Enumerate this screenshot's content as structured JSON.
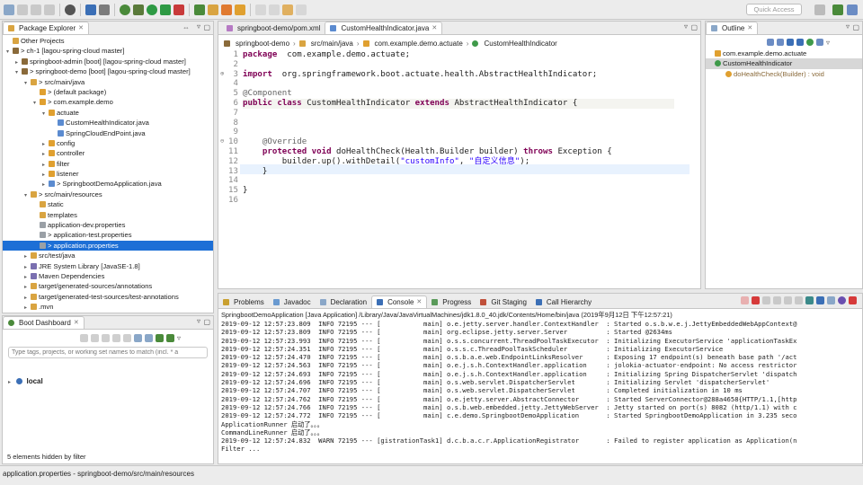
{
  "toolbar": {
    "quick_access_placeholder": "Quick Access"
  },
  "package_explorer": {
    "tab_label": "Package Explorer",
    "items": [
      {
        "label": "Other Projects",
        "indent": 0,
        "arrow": "",
        "icon": "folder-icon",
        "color": "#d9a441"
      },
      {
        "label": "> ch-1 [lagou-spring-cloud master]",
        "indent": 0,
        "arrow": "▾",
        "icon": "project-icon",
        "color": "#8a6a3a"
      },
      {
        "label": "springboot-admin [boot] [lagou-spring-cloud master]",
        "indent": 1,
        "arrow": "▸",
        "icon": "project-icon",
        "color": "#8a6a3a"
      },
      {
        "label": "> springboot-demo [boot] [lagou-spring-cloud master]",
        "indent": 1,
        "arrow": "▾",
        "icon": "project-icon",
        "color": "#8a6a3a"
      },
      {
        "label": "> src/main/java",
        "indent": 2,
        "arrow": "▾",
        "icon": "source-folder-icon",
        "color": "#d9a441"
      },
      {
        "label": "> (default package)",
        "indent": 3,
        "arrow": "",
        "icon": "package-icon",
        "color": "#e0a030"
      },
      {
        "label": "> com.example.demo",
        "indent": 3,
        "arrow": "▾",
        "icon": "package-icon",
        "color": "#e0a030"
      },
      {
        "label": "actuate",
        "indent": 4,
        "arrow": "▾",
        "icon": "package-icon",
        "color": "#e0a030"
      },
      {
        "label": "CustomHealthIndicator.java",
        "indent": 5,
        "arrow": "",
        "icon": "java-file-icon",
        "color": "#5b8bd0"
      },
      {
        "label": "SpringCloudEndPoint.java",
        "indent": 5,
        "arrow": "",
        "icon": "java-file-icon",
        "color": "#5b8bd0"
      },
      {
        "label": "config",
        "indent": 4,
        "arrow": "▸",
        "icon": "package-icon",
        "color": "#e0a030"
      },
      {
        "label": "controller",
        "indent": 4,
        "arrow": "▸",
        "icon": "package-icon",
        "color": "#e0a030"
      },
      {
        "label": "filter",
        "indent": 4,
        "arrow": "▸",
        "icon": "package-icon",
        "color": "#e0a030"
      },
      {
        "label": "listener",
        "indent": 4,
        "arrow": "▸",
        "icon": "package-icon",
        "color": "#e0a030"
      },
      {
        "label": "> SpringbootDemoApplication.java",
        "indent": 4,
        "arrow": "▸",
        "icon": "java-file-icon",
        "color": "#5b8bd0"
      },
      {
        "label": "> src/main/resources",
        "indent": 2,
        "arrow": "▾",
        "icon": "source-folder-icon",
        "color": "#d9a441"
      },
      {
        "label": "static",
        "indent": 3,
        "arrow": "",
        "icon": "folder-icon",
        "color": "#d9a441"
      },
      {
        "label": "templates",
        "indent": 3,
        "arrow": "",
        "icon": "folder-icon",
        "color": "#d9a441"
      },
      {
        "label": "application-dev.properties",
        "indent": 3,
        "arrow": "",
        "icon": "properties-file-icon",
        "color": "#9aa0a6"
      },
      {
        "label": "> application-test.properties",
        "indent": 3,
        "arrow": "",
        "icon": "properties-file-icon",
        "color": "#9aa0a6"
      },
      {
        "label": "> application.properties",
        "indent": 3,
        "arrow": "",
        "icon": "properties-file-icon",
        "color": "#9aa0a6",
        "selected": true
      },
      {
        "label": "src/test/java",
        "indent": 2,
        "arrow": "▸",
        "icon": "source-folder-icon",
        "color": "#d9a441"
      },
      {
        "label": "JRE System Library [JavaSE-1.8]",
        "indent": 2,
        "arrow": "▸",
        "icon": "library-icon",
        "color": "#7a6fb0"
      },
      {
        "label": "Maven Dependencies",
        "indent": 2,
        "arrow": "▸",
        "icon": "library-icon",
        "color": "#7a6fb0"
      },
      {
        "label": "target/generated-sources/annotations",
        "indent": 2,
        "arrow": "▸",
        "icon": "source-folder-icon",
        "color": "#d9a441"
      },
      {
        "label": "target/generated-test-sources/test-annotations",
        "indent": 2,
        "arrow": "▸",
        "icon": "source-folder-icon",
        "color": "#d9a441"
      },
      {
        "label": ".mvn",
        "indent": 2,
        "arrow": "▸",
        "icon": "folder-icon",
        "color": "#d9a441"
      }
    ]
  },
  "boot_dashboard": {
    "tab_label": "Boot Dashboard",
    "search_placeholder": "Type tags, projects, or working set names to match (incl. * a",
    "local_label": "local",
    "hidden_note": "5 elements hidden by filter"
  },
  "editor": {
    "tabs": [
      {
        "label": "springboot-demo/pom.xml",
        "active": false
      },
      {
        "label": "CustomHealthIndicator.java",
        "active": true
      }
    ],
    "breadcrumb": [
      "springboot-demo",
      "src/main/java",
      "com.example.demo.actuate",
      "CustomHealthIndicator"
    ],
    "lines": [
      {
        "n": "1",
        "marker": "",
        "parts": [
          [
            "kw",
            "package"
          ],
          [
            "",
            "  com.example.demo.actuate;"
          ]
        ]
      },
      {
        "n": "2",
        "marker": "",
        "parts": []
      },
      {
        "n": "3",
        "marker": "⊕",
        "parts": [
          [
            "kw",
            "import"
          ],
          [
            "",
            "  org.springframework.boot.actuate.health.AbstractHealthIndicator;"
          ]
        ]
      },
      {
        "n": "4",
        "marker": "",
        "parts": []
      },
      {
        "n": "5",
        "marker": "",
        "parts": [
          [
            "an",
            "@Component"
          ]
        ]
      },
      {
        "n": "6",
        "marker": "",
        "parts": [
          [
            "kw",
            "public"
          ],
          [
            "",
            " "
          ],
          [
            "kw",
            "class"
          ],
          [
            "",
            " CustomHealthIndicator "
          ],
          [
            "kw",
            "extends"
          ],
          [
            "",
            " AbstractHealthIndicator {"
          ]
        ]
      },
      {
        "n": "7",
        "marker": "",
        "parts": []
      },
      {
        "n": "8",
        "marker": "",
        "parts": []
      },
      {
        "n": "9",
        "marker": "",
        "parts": []
      },
      {
        "n": "10",
        "marker": "⊖",
        "parts": [
          [
            "",
            "    "
          ],
          [
            "an",
            "@Override"
          ]
        ]
      },
      {
        "n": "11",
        "marker": "",
        "parts": [
          [
            "",
            "    "
          ],
          [
            "kw",
            "protected"
          ],
          [
            "",
            " "
          ],
          [
            "kw",
            "void"
          ],
          [
            "",
            " doHealthCheck(Health.Builder builder) "
          ],
          [
            "kw",
            "throws"
          ],
          [
            "",
            " Exception {"
          ]
        ]
      },
      {
        "n": "12",
        "marker": "",
        "parts": [
          [
            "",
            "        builder.up().withDetail("
          ],
          [
            "str",
            "\"customInfo\""
          ],
          [
            "",
            ", "
          ],
          [
            "str",
            "\"自定义信息\""
          ],
          [
            "",
            ");"
          ]
        ]
      },
      {
        "n": "13",
        "marker": "",
        "parts": [
          [
            "",
            "    }"
          ]
        ]
      },
      {
        "n": "14",
        "marker": "",
        "parts": []
      },
      {
        "n": "15",
        "marker": "",
        "parts": [
          [
            "",
            "}"
          ]
        ]
      },
      {
        "n": "16",
        "marker": "",
        "parts": []
      }
    ]
  },
  "outline": {
    "tab_label": "Outline",
    "items": [
      {
        "label": "com.example.demo.actuate",
        "indent": 0
      },
      {
        "label": "CustomHealthIndicator",
        "indent": 0,
        "selected": true
      },
      {
        "label": "doHealthCheck(Builder) : void",
        "indent": 1
      }
    ]
  },
  "bottom_tabs": [
    {
      "label": "Problems",
      "active": false
    },
    {
      "label": "Javadoc",
      "active": false
    },
    {
      "label": "Declaration",
      "active": false
    },
    {
      "label": "Console",
      "active": true
    },
    {
      "label": "Progress",
      "active": false
    },
    {
      "label": "Git Staging",
      "active": false
    },
    {
      "label": "Call Hierarchy",
      "active": false
    }
  ],
  "console": {
    "header": "SpringbootDemoApplication [Java Application] /Library/Java/JavaVirtualMachines/jdk1.8.0_40.jdk/Contents/Home/bin/java (2019年9月12日 下午12:57:21)",
    "lines": [
      "2019-09-12 12:57:23.809  INFO 72195 --- [           main] o.e.jetty.server.handler.ContextHandler  : Started o.s.b.w.e.j.JettyEmbeddedWebAppContext@",
      "2019-09-12 12:57:23.809  INFO 72195 --- [           main] org.eclipse.jetty.server.Server          : Started @2634ms",
      "2019-09-12 12:57:23.993  INFO 72195 --- [           main] o.s.s.concurrent.ThreadPoolTaskExecutor  : Initializing ExecutorService 'applicationTaskEx",
      "2019-09-12 12:57:24.351  INFO 72195 --- [           main] o.s.s.c.ThreadPoolTaskScheduler          : Initializing ExecutorService",
      "2019-09-12 12:57:24.470  INFO 72195 --- [           main] o.s.b.a.e.web.EndpointLinksResolver      : Exposing 17 endpoint(s) beneath base path '/act",
      "2019-09-12 12:57:24.563  INFO 72195 --- [           main] o.e.j.s.h.ContextHandler.application     : jolokia-actuator-endpoint: No access restrictor",
      "2019-09-12 12:57:24.693  INFO 72195 --- [           main] o.e.j.s.h.ContextHandler.application     : Initializing Spring DispatcherServlet 'dispatch",
      "2019-09-12 12:57:24.696  INFO 72195 --- [           main] o.s.web.servlet.DispatcherServlet        : Initializing Servlet 'dispatcherServlet'",
      "2019-09-12 12:57:24.707  INFO 72195 --- [           main] o.s.web.servlet.DispatcherServlet        : Completed initialization in 10 ms",
      "2019-09-12 12:57:24.762  INFO 72195 --- [           main] o.e.jetty.server.AbstractConnector       : Started ServerConnector@288a4658{HTTP/1.1,[http",
      "2019-09-12 12:57:24.766  INFO 72195 --- [           main] o.s.b.web.embedded.jetty.JettyWebServer  : Jetty started on port(s) 8082 (http/1.1) with c",
      "2019-09-12 12:57:24.772  INFO 72195 --- [           main] c.e.demo.SpringbootDemoApplication       : Started SpringbootDemoApplication in 3.235 seco",
      "ApplicationRunner 启动了。。。",
      "CommandLineRunner 启动了。。。",
      "2019-09-12 12:57:24.832  WARN 72195 --- [gistrationTask1] d.c.b.a.c.r.ApplicationRegistrator       : Failed to register application as Application(n",
      "Filter ..."
    ]
  },
  "status_bar": {
    "text": "application.properties - springboot-demo/src/main/resources"
  },
  "colors": {
    "selection": "#1d6fd6",
    "keyword": "#7f0055",
    "string": "#2a00ff",
    "annotation": "#646464"
  }
}
